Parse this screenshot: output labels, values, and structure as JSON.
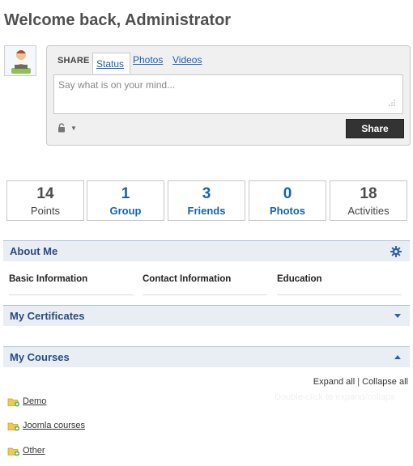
{
  "page": {
    "title": "Welcome back, Administrator"
  },
  "share": {
    "label": "SHARE",
    "tabs": [
      "Status",
      "Photos",
      "Videos"
    ],
    "placeholder": "Say what is on your mind...",
    "button": "Share"
  },
  "stats": [
    {
      "value": "14",
      "label": "Points"
    },
    {
      "value": "1",
      "label": "Group"
    },
    {
      "value": "3",
      "label": "Friends"
    },
    {
      "value": "0",
      "label": "Photos"
    },
    {
      "value": "18",
      "label": "Activities"
    }
  ],
  "about": {
    "title": "About Me",
    "columns": [
      "Basic Information",
      "Contact Information",
      "Education"
    ]
  },
  "certificates": {
    "title": "My Certificates"
  },
  "courses": {
    "title": "My Courses",
    "expand_all": "Expand all",
    "collapse_all": "Collapse all",
    "hint": "Double-click to expand/collaps",
    "items": [
      "Demo",
      "Joomla courses",
      "Other"
    ]
  },
  "colors": {
    "link": "#1464b4",
    "section_title": "#2a4a7f",
    "section_bg": "#e9eef5"
  }
}
